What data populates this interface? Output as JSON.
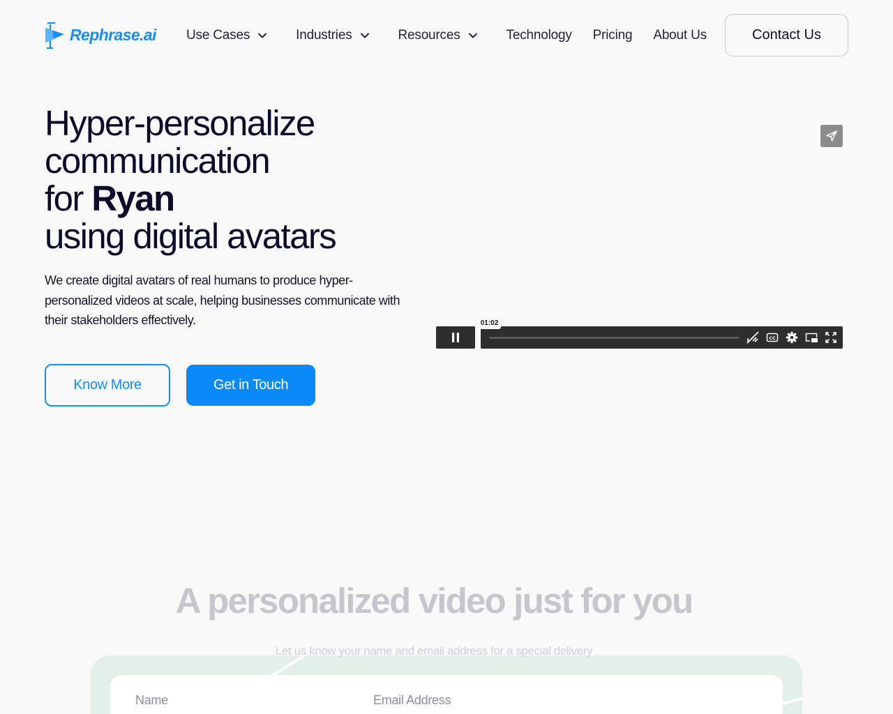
{
  "header": {
    "logo_text": "Rephrase.ai",
    "nav": [
      {
        "label": "Use Cases",
        "has_dropdown": true
      },
      {
        "label": "Industries",
        "has_dropdown": true
      },
      {
        "label": "Resources",
        "has_dropdown": true
      },
      {
        "label": "Technology",
        "has_dropdown": false
      },
      {
        "label": "Pricing",
        "has_dropdown": false
      },
      {
        "label": "About Us",
        "has_dropdown": false
      }
    ],
    "contact_label": "Contact Us"
  },
  "hero": {
    "title_line1": "Hyper-personalize",
    "title_line2": "communication",
    "title_for": "for",
    "title_name": "Ryan",
    "title_line4": "using digital avatars",
    "description": "We create digital avatars of real humans to produce hyper-personalized videos at scale, helping businesses communicate with their stakeholders effectively.",
    "know_more_label": "Know More",
    "get_in_touch_label": "Get in Touch"
  },
  "video": {
    "time": "01:02",
    "progress": 0,
    "icons": [
      "share-icon",
      "pause-icon",
      "volume-muted-icon",
      "captions-icon",
      "settings-icon",
      "picture-in-picture-icon",
      "fullscreen-icon"
    ]
  },
  "personalized": {
    "title_bold": "A personalized video",
    "title_regular": "just for you",
    "subtitle": "Let us know your name and email address for a special delivery",
    "name_label": "Name",
    "email_label": "Email Address"
  },
  "colors": {
    "accent": "#1a8cf5",
    "primary_button": "#0a8af7",
    "text_dark": "#0c0c2a",
    "background": "#f9f9fa",
    "player_bar": "#2e2e2e",
    "form_bg": "#e3efe9"
  }
}
